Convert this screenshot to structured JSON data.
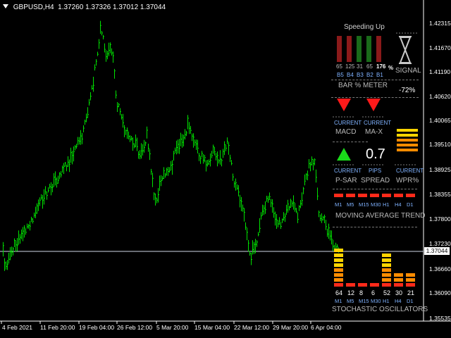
{
  "title": {
    "symbol": "GBPUSD,H4",
    "ohlc": "1.37260 1.37326 1.37012 1.37044"
  },
  "price_axis": {
    "labels": [
      "1.42315",
      "1.41670",
      "1.41190",
      "1.40620",
      "1.40065",
      "1.39510",
      "1.38925",
      "1.38355",
      "1.37800",
      "1.37230",
      "1.36660",
      "1.36090",
      "1.35535"
    ],
    "current_price": "1.37044"
  },
  "time_axis": {
    "labels": [
      "4 Feb 2021",
      "11 Feb 20:00",
      "19 Feb 04:00",
      "26 Feb 12:00",
      "5 Mar 20:00",
      "15 Mar 04:00",
      "22 Mar 12:00",
      "29 Mar 20:00",
      "6 Apr 04:00"
    ]
  },
  "indicator": {
    "speeding_title": "Speeding Up",
    "bar_values": [
      "65",
      "125",
      "31",
      "65",
      "176"
    ],
    "bar_pct": "%",
    "bar_labels": [
      "B5",
      "B4",
      "B3",
      "B2",
      "B1"
    ],
    "bar_meter_title": "BAR % METER",
    "signal_label": "SIGNAL",
    "signal_value": "-72%",
    "current_label": "CURRENT",
    "macd_label": "MACD",
    "max_label": "MA-X",
    "psar_label": "P-SAR",
    "pips_value": "0.7",
    "pips_label": "PIPS",
    "spread_label": "SPREAD",
    "wpr_label": "WPR%",
    "ma_timeframes": [
      "M1",
      "M5",
      "M15",
      "M30",
      "H1",
      "H4",
      "D1"
    ],
    "ma_trend_title": "MOVING AVERAGE TREND",
    "stoch_values": [
      "64",
      "12",
      "8",
      "6",
      "52",
      "30",
      "21"
    ],
    "stoch_timeframes": [
      "M1",
      "M5",
      "M15",
      "M30",
      "H1",
      "H4",
      "D1"
    ],
    "stoch_title": "STOCHASTIC OSCILLATORS"
  },
  "colors": {
    "candle": "#00e000",
    "bear_bar": "#8b1a1a",
    "bull_bar": "#1a6b1a",
    "arrow_down": "#ff1a1a",
    "arrow_up": "#1adb1a",
    "ma_trend": "#ff2a1a",
    "level_yellow": "#ffd400",
    "level_orange": "#ff8c00",
    "level_red": "#ff2a1a"
  }
}
